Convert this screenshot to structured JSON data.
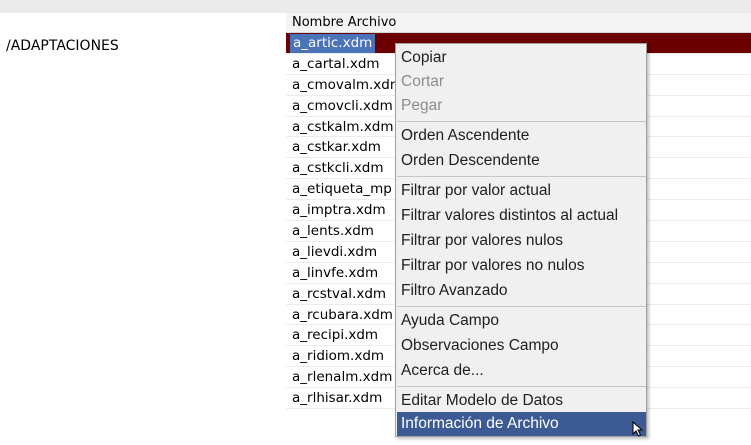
{
  "path": "/ADAPTACIONES",
  "grid": {
    "column_header": "Nombre Archivo",
    "rows": [
      "a_artic.xdm",
      "a_cartal.xdm",
      "a_cmovalm.xdm",
      "a_cmovcli.xdm",
      "a_cstkalm.xdm",
      "a_cstkar.xdm",
      "a_cstkcli.xdm",
      "a_etiqueta_mp",
      "a_imptra.xdm",
      "a_lents.xdm",
      "a_lievdi.xdm",
      "a_linvfe.xdm",
      "a_rcstval.xdm",
      "a_rcubara.xdm",
      "a_recipi.xdm",
      "a_ridiom.xdm",
      "a_rlenalm.xdm",
      "a_rlhisar.xdm"
    ],
    "selected_index": 0
  },
  "context_menu": {
    "items": [
      {
        "label": "Copiar",
        "enabled": true
      },
      {
        "label": "Cortar",
        "enabled": false
      },
      {
        "label": "Pegar",
        "enabled": false
      },
      {
        "label": "Orden Ascendente",
        "enabled": true
      },
      {
        "label": "Orden Descendente",
        "enabled": true
      },
      {
        "label": "Filtrar por valor actual",
        "enabled": true
      },
      {
        "label": "Filtrar valores distintos al actual",
        "enabled": true
      },
      {
        "label": "Filtrar por valores nulos",
        "enabled": true
      },
      {
        "label": "Filtrar por valores no nulos",
        "enabled": true
      },
      {
        "label": "Filtro Avanzado",
        "enabled": true
      },
      {
        "label": "Ayuda Campo",
        "enabled": true
      },
      {
        "label": "Observaciones Campo",
        "enabled": true
      },
      {
        "label": "Acerca de...",
        "enabled": true
      },
      {
        "label": "Editar Modelo de Datos",
        "enabled": true
      },
      {
        "label": "Información de Archivo",
        "enabled": true,
        "highlighted": true
      }
    ]
  },
  "colors": {
    "selected_row": "#6b0000",
    "selected_cell": "#4a73b8",
    "menu_highlight": "#3c5a94",
    "disabled_text": "#8c8c8c"
  },
  "icons": {
    "cursor": "mouse-pointer-icon"
  }
}
